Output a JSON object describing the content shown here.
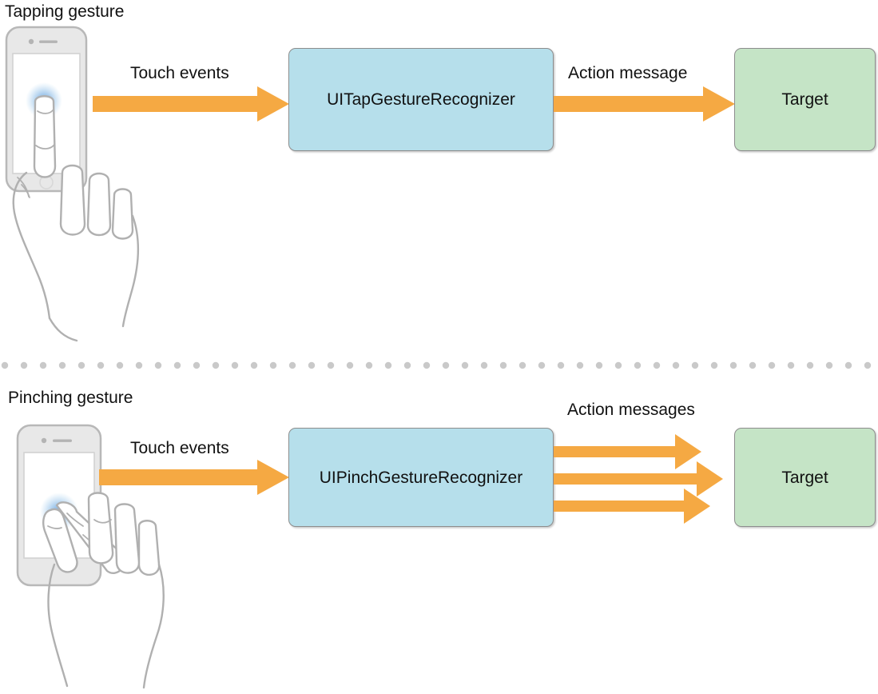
{
  "diagram": {
    "title_tapping": "Tapping gesture",
    "title_pinching": "Pinching gesture",
    "colors": {
      "arrow_orange": "#f5a943",
      "recognizer_blue": "#b6dfeb",
      "target_green": "#c5e4c6",
      "box_border_gray": "#8d8d8d",
      "divider_dot_gray": "#c9c9c9",
      "illustration_line": "#b0b0b0",
      "device_body": "#e6e6e6",
      "touch_glow_blue": "#5b9bd5"
    },
    "sections": [
      {
        "name": "tapping",
        "title": "Tapping gesture",
        "input_label": "Touch events",
        "recognizer": "UITapGestureRecognizer",
        "output_label": "Action message",
        "target": "Target",
        "output_arrow_count": 1
      },
      {
        "name": "pinching",
        "title": "Pinching gesture",
        "input_label": "Touch events",
        "recognizer": "UIPinchGestureRecognizer",
        "output_label": "Action messages",
        "target": "Target",
        "output_arrow_count": 3
      }
    ],
    "labels": {
      "touch_events": "Touch events",
      "action_message": "Action message",
      "action_messages": "Action messages",
      "target": "Target",
      "tap_recognizer": "UITapGestureRecognizer",
      "pinch_recognizer": "UIPinchGestureRecognizer"
    },
    "illustrations": {
      "tap_device": "phone-tapping-hand-illustration",
      "pinch_device": "phone-pinching-hand-illustration"
    },
    "divider": "dotted-horizontal-divider"
  }
}
